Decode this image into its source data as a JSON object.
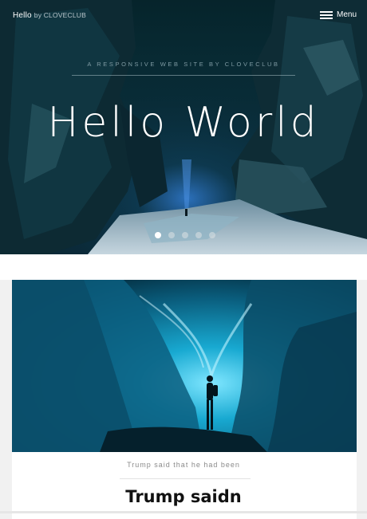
{
  "header": {
    "brand_name": "Hello",
    "brand_by": "by CLOVECLUB",
    "menu_label": "Menu"
  },
  "hero": {
    "tagline": "A RESPONSIVE WEB SITE BY CLOVECLUB",
    "title": "Hello World",
    "slide_count": 5,
    "active_slide": 1
  },
  "article": {
    "subtitle": "Trump said that he had been",
    "title": "Trump saidn"
  },
  "colors": {
    "hero_bg": "#061a22",
    "ice_cyan": "#1aa7c9",
    "page_bg": "#f1f1f1"
  }
}
